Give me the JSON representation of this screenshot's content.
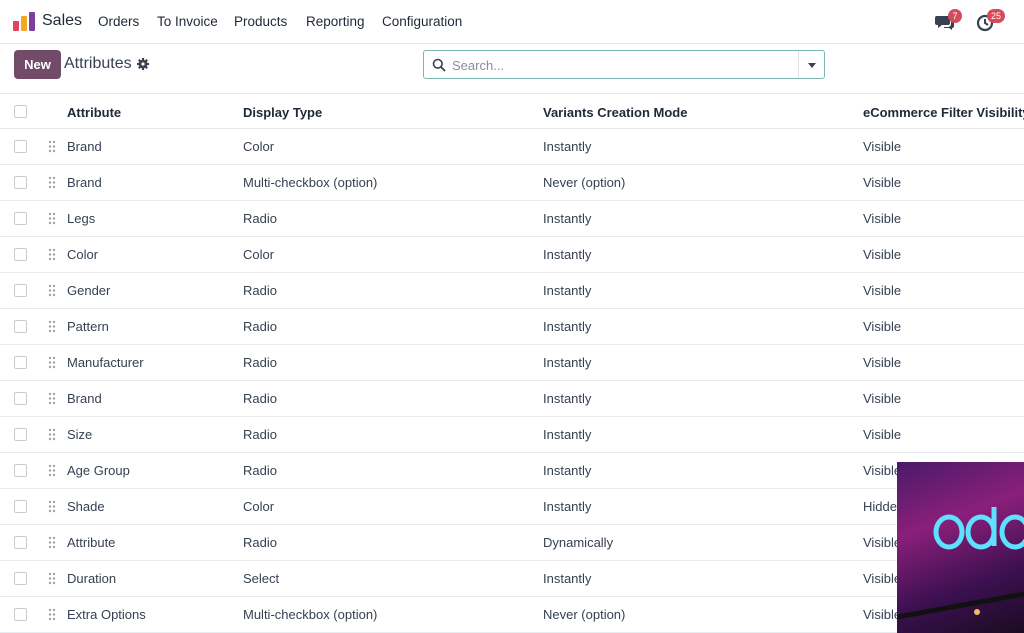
{
  "navbar": {
    "app_name": "Sales",
    "menu": [
      "Orders",
      "To Invoice",
      "Products",
      "Reporting",
      "Configuration"
    ],
    "messages_badge": "7",
    "activities_badge": "25"
  },
  "control_panel": {
    "new_label": "New",
    "title": "Attributes",
    "search_placeholder": "Search..."
  },
  "table": {
    "headers": [
      "Attribute",
      "Display Type",
      "Variants Creation Mode",
      "eCommerce Filter Visibility"
    ],
    "rows": [
      [
        "Brand",
        "Color",
        "Instantly",
        "Visible"
      ],
      [
        "Brand",
        "Multi-checkbox (option)",
        "Never (option)",
        "Visible"
      ],
      [
        "Legs",
        "Radio",
        "Instantly",
        "Visible"
      ],
      [
        "Color",
        "Color",
        "Instantly",
        "Visible"
      ],
      [
        "Gender",
        "Radio",
        "Instantly",
        "Visible"
      ],
      [
        "Pattern",
        "Radio",
        "Instantly",
        "Visible"
      ],
      [
        "Manufacturer",
        "Radio",
        "Instantly",
        "Visible"
      ],
      [
        "Brand",
        "Radio",
        "Instantly",
        "Visible"
      ],
      [
        "Size",
        "Radio",
        "Instantly",
        "Visible"
      ],
      [
        "Age Group",
        "Radio",
        "Instantly",
        "Visible"
      ],
      [
        "Shade",
        "Color",
        "Instantly",
        "Hidden"
      ],
      [
        "Attribute",
        "Radio",
        "Dynamically",
        "Visible"
      ],
      [
        "Duration",
        "Select",
        "Instantly",
        "Visible"
      ],
      [
        "Extra Options",
        "Multi-checkbox (option)",
        "Never (option)",
        "Visible"
      ]
    ]
  },
  "colors": {
    "primary": "#714b67",
    "badge": "#d44c59",
    "search_border": "#7bb7b0"
  }
}
